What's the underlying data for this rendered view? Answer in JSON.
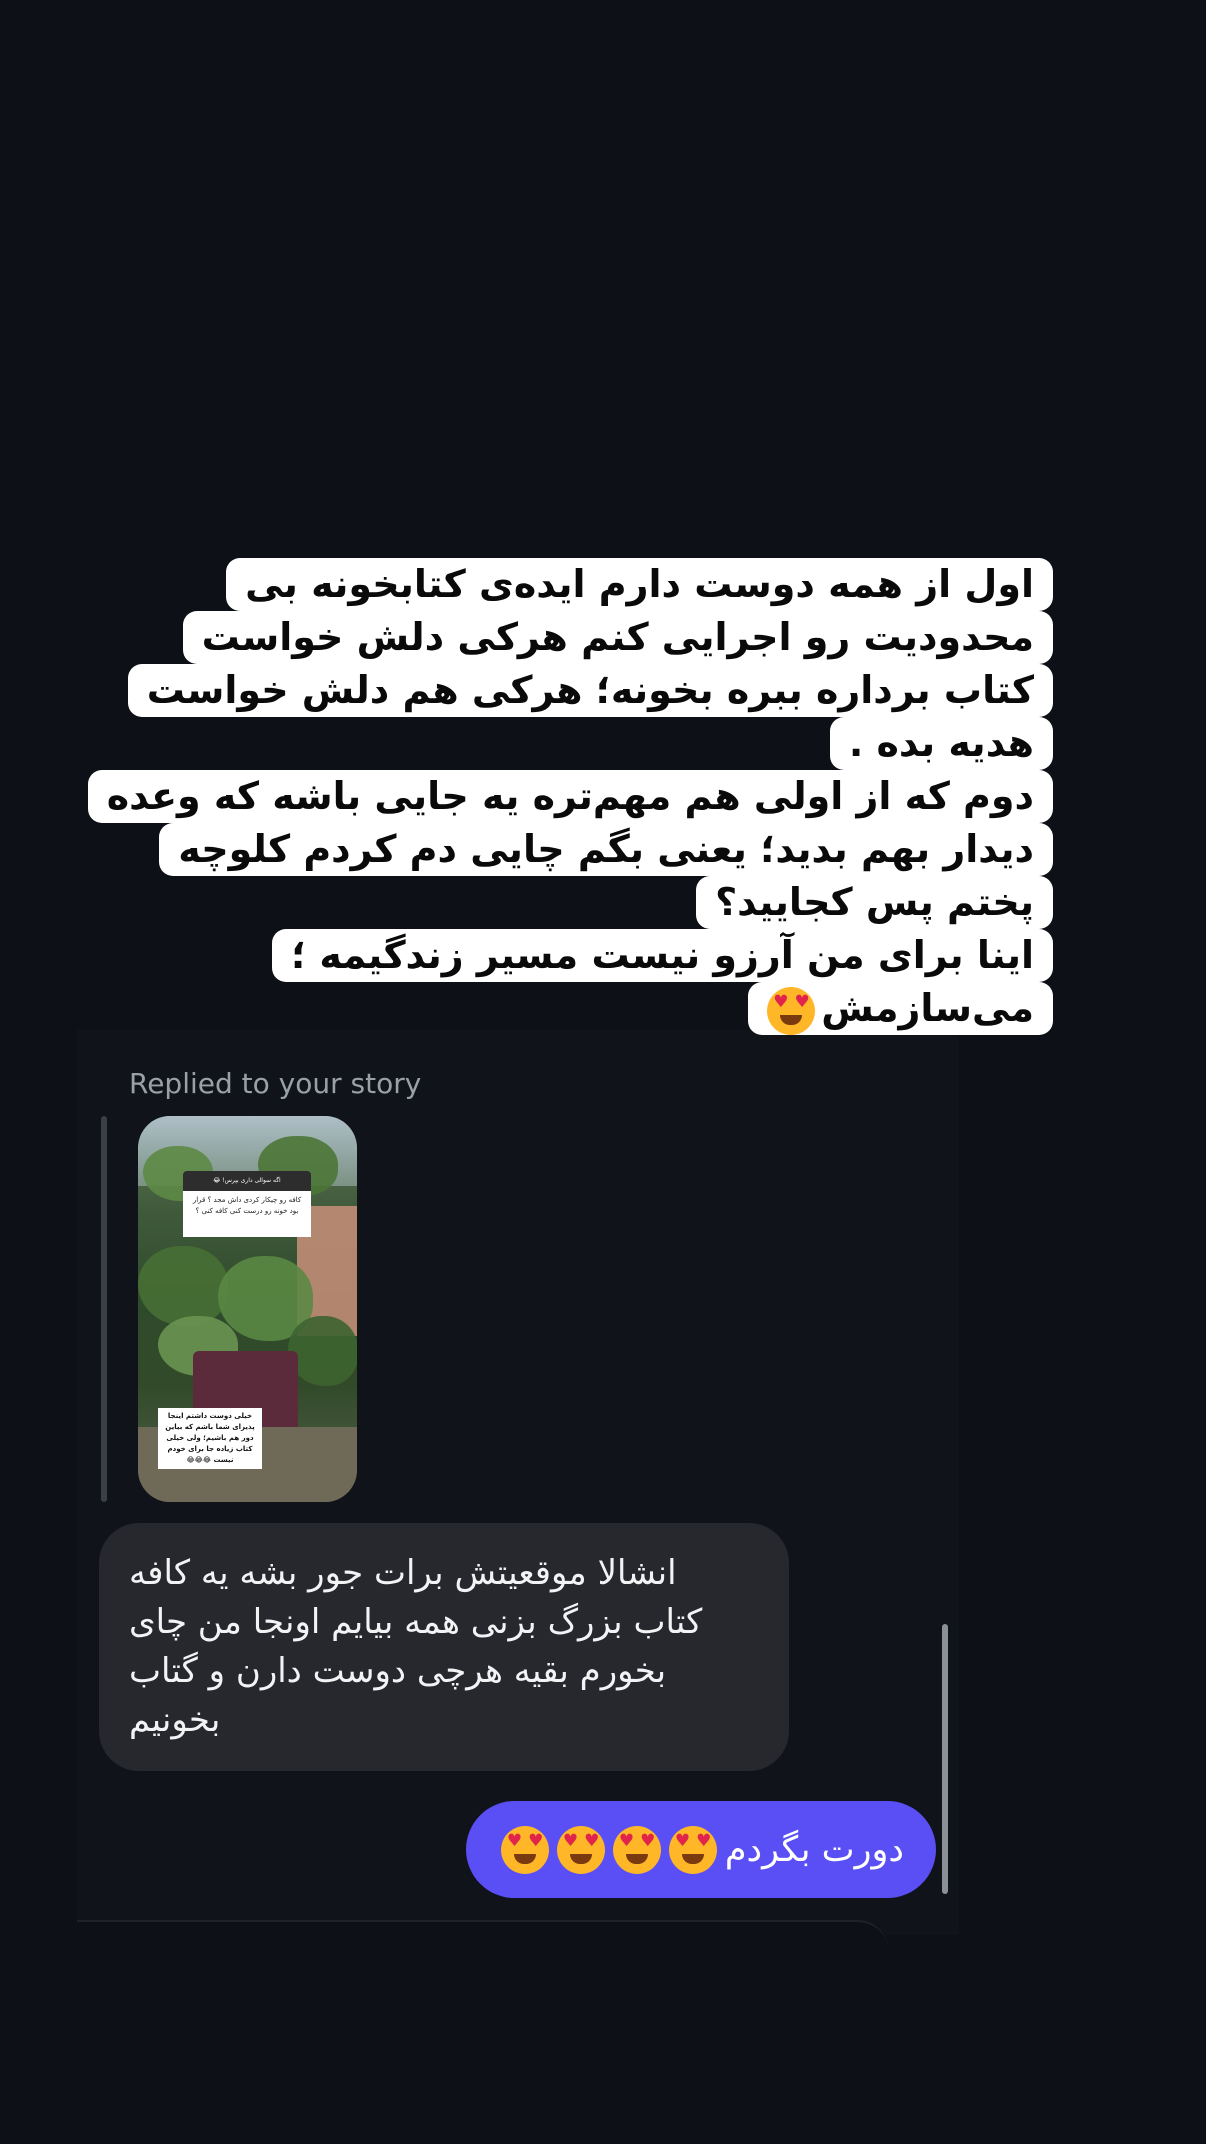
{
  "story_caption": {
    "lines": [
      "اول از همه دوست دارم ایده‌ی کتابخونه بی",
      "محدودیت رو اجرایی کنم هرکی دلش خواست",
      "کتاب برداره ببره بخونه؛ هرکی هم دلش خواست",
      "هدیه بده .",
      "دوم که از اولی هم مهم‌تره یه جایی باشه که وعده",
      "دیدار بهم بدید؛ یعنی بگم چایی دم کردم کلوچه",
      "پختم پس کجایید؟",
      "اینا برای من آرزو نیست مسیر زندگیمه ؛",
      "می‌سازمش"
    ],
    "emoji": "heart-eyes-emoji"
  },
  "reply_label": "Replied to your story",
  "story_thumbnail": {
    "question_header": "اگه سوالی داری بپرس! 😂",
    "question_text": "کافه رو چیکار کردی داش مجد ؟ قرار بود خونه رو درست کنی کافه کنی ؟",
    "answer_text": "خیلی دوست داشتم اینجا پذیرای شما باشم که بیاین دور هم باشیم؛ ولی خیلی کتاب زیاده جا برای خودم نیست 😂😂😂"
  },
  "incoming_message": {
    "text": "انشالا موقعیتش برات جور بشه یه کافه\nکتاب بزرگ بزنی همه بیایم اونجا من چای\nبخورم بقیه هرچی دوست دارن و گتاب\nبخونیم"
  },
  "outgoing_message": {
    "text": "دورت بگردم",
    "emojis": [
      "heart-eyes-emoji",
      "heart-eyes-emoji",
      "heart-eyes-emoji",
      "heart-eyes-emoji"
    ]
  },
  "colors": {
    "background": "#0d1017",
    "incoming_bubble": "#26282e",
    "outgoing_bubble": "#5a4ff5",
    "caption_bg": "#ffffff"
  }
}
